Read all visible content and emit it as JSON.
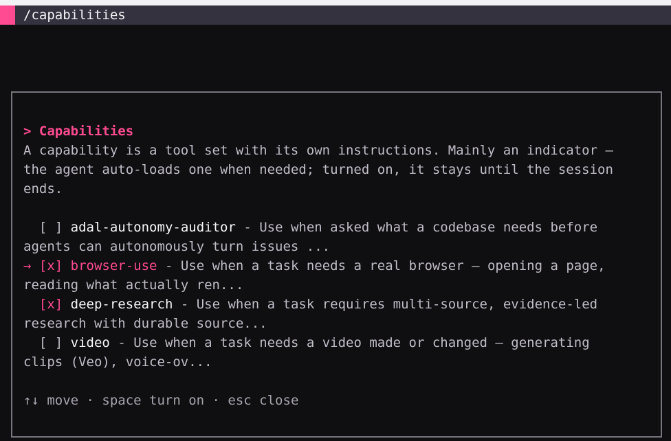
{
  "title_bar": {
    "path": "/capabilities"
  },
  "panel": {
    "heading": "> Capabilities",
    "description_lines": [
      "A capability is a tool set with its own instructions. Mainly an indicator —",
      "the agent auto-loads one when needed; turned on, it stays until the session",
      "ends."
    ],
    "items": [
      {
        "cursor": "  ",
        "checkbox": "[ ]",
        "name": "adal-autonomy-auditor",
        "desc_first": " - Use when asked what a codebase needs before",
        "desc_second": "agents can autonomously turn issues ..."
      },
      {
        "cursor": "→ ",
        "checkbox": "[x]",
        "name": "browser-use",
        "desc_first": " - Use when a task needs a real browser — opening a page,",
        "desc_second": "reading what actually ren..."
      },
      {
        "cursor": "  ",
        "checkbox": "[x]",
        "name": "deep-research",
        "desc_first": " - Use when a task requires multi-source, evidence-led",
        "desc_second": "research with durable source..."
      },
      {
        "cursor": "  ",
        "checkbox": "[ ]",
        "name": "video",
        "desc_first": " - Use when a task needs a video made or changed — generating",
        "desc_second": "clips (Veo), voice-ov..."
      }
    ],
    "help": {
      "move_icon": "↑↓",
      "text": " move · space turn on · esc close"
    }
  },
  "colors": {
    "accent": "#ff4b91",
    "background": "#0f0e11",
    "title_bar": "#34323f"
  }
}
